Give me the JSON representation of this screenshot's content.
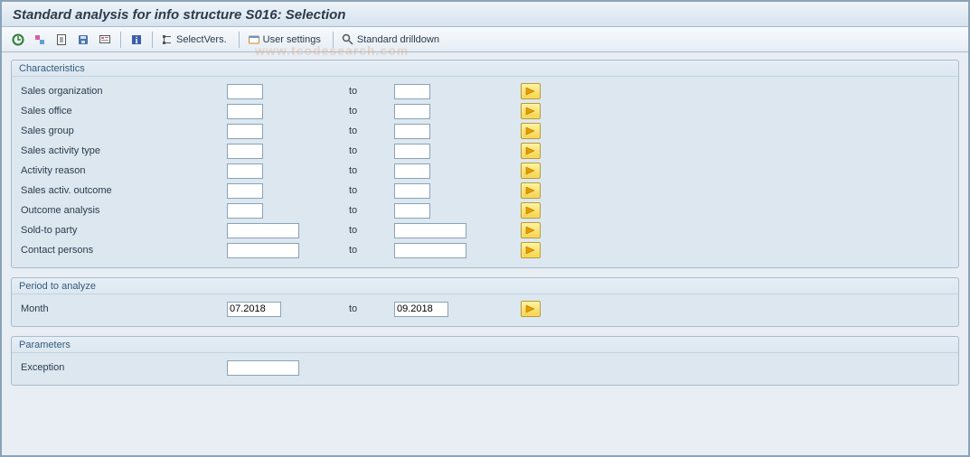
{
  "title": "Standard analysis for info structure S016: Selection",
  "watermark": "www.tcodesearch.com",
  "toolbar": {
    "select_vers": "SelectVers.",
    "user_settings": "User settings",
    "std_drilldown": "Standard drilldown"
  },
  "groups": {
    "characteristics": {
      "title": "Characteristics",
      "rows": [
        {
          "label": "Sales organization",
          "from": "",
          "to": "",
          "width": "short"
        },
        {
          "label": "Sales office",
          "from": "",
          "to": "",
          "width": "short"
        },
        {
          "label": "Sales group",
          "from": "",
          "to": "",
          "width": "short"
        },
        {
          "label": "Sales activity type",
          "from": "",
          "to": "",
          "width": "short"
        },
        {
          "label": "Activity reason",
          "from": "",
          "to": "",
          "width": "short"
        },
        {
          "label": "Sales activ. outcome",
          "from": "",
          "to": "",
          "width": "short"
        },
        {
          "label": "Outcome analysis",
          "from": "",
          "to": "",
          "width": "short"
        },
        {
          "label": "Sold-to party",
          "from": "",
          "to": "",
          "width": "med"
        },
        {
          "label": "Contact persons",
          "from": "",
          "to": "",
          "width": "med"
        }
      ],
      "to_label": "to"
    },
    "period": {
      "title": "Period to analyze",
      "row": {
        "label": "Month",
        "from": "07.2018",
        "to": "09.2018"
      },
      "to_label": "to"
    },
    "parameters": {
      "title": "Parameters",
      "row": {
        "label": "Exception",
        "value": ""
      }
    }
  }
}
